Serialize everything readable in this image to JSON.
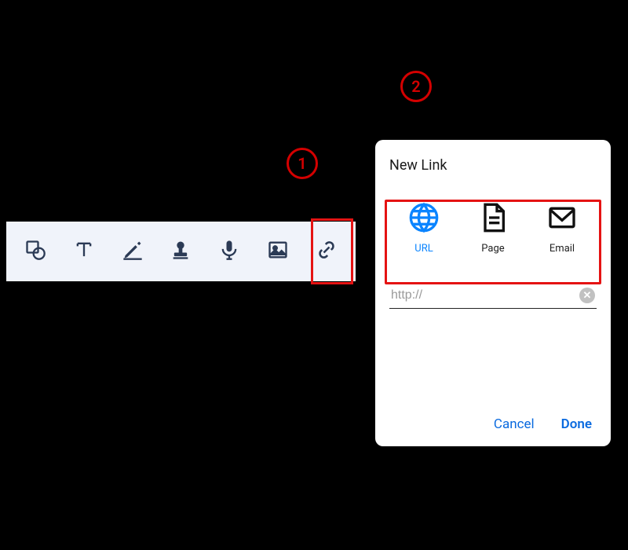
{
  "steps": {
    "one": "1",
    "two": "2"
  },
  "toolbar": {
    "items": [
      {
        "name": "shape-icon"
      },
      {
        "name": "text-icon"
      },
      {
        "name": "pen-icon"
      },
      {
        "name": "stamp-icon"
      },
      {
        "name": "mic-icon"
      },
      {
        "name": "image-icon"
      },
      {
        "name": "link-icon"
      }
    ]
  },
  "dialog": {
    "title": "New Link",
    "types": {
      "url": "URL",
      "page": "Page",
      "email": "Email"
    },
    "url_value": "http://",
    "actions": {
      "cancel": "Cancel",
      "done": "Done"
    }
  },
  "colors": {
    "highlight": "#e51313",
    "accent": "#0a84ff",
    "link_action": "#0a6adf"
  }
}
